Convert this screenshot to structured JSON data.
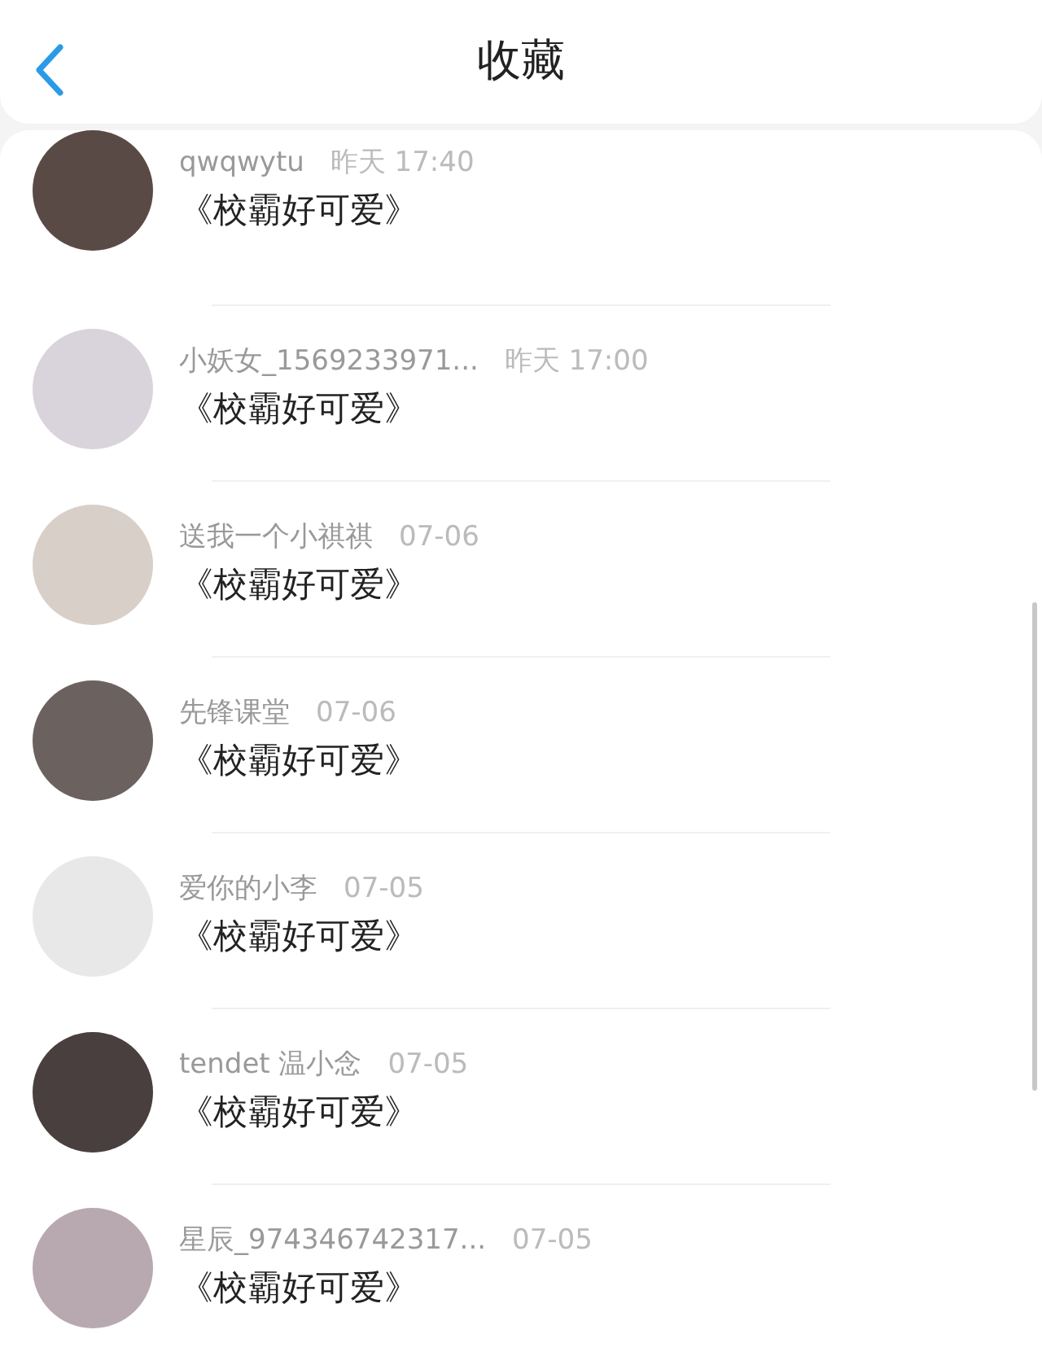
{
  "header": {
    "title": "收藏"
  },
  "items": [
    {
      "user": "qwqwytu",
      "time": "昨天 17:40",
      "title": "《校霸好可爱》"
    },
    {
      "user": "小妖女_1569233971...",
      "time": "昨天 17:00",
      "title": "《校霸好可爱》"
    },
    {
      "user": "送我一个小祺祺",
      "time": "07-06",
      "title": "《校霸好可爱》"
    },
    {
      "user": "先锋课堂",
      "time": "07-06",
      "title": "《校霸好可爱》"
    },
    {
      "user": "爱你的小李",
      "time": "07-05",
      "title": "《校霸好可爱》"
    },
    {
      "user": "tendet 温小念",
      "time": "07-05",
      "title": "《校霸好可爱》"
    },
    {
      "user": "星辰_974346742317...",
      "time": "07-05",
      "title": "《校霸好可爱》"
    }
  ]
}
